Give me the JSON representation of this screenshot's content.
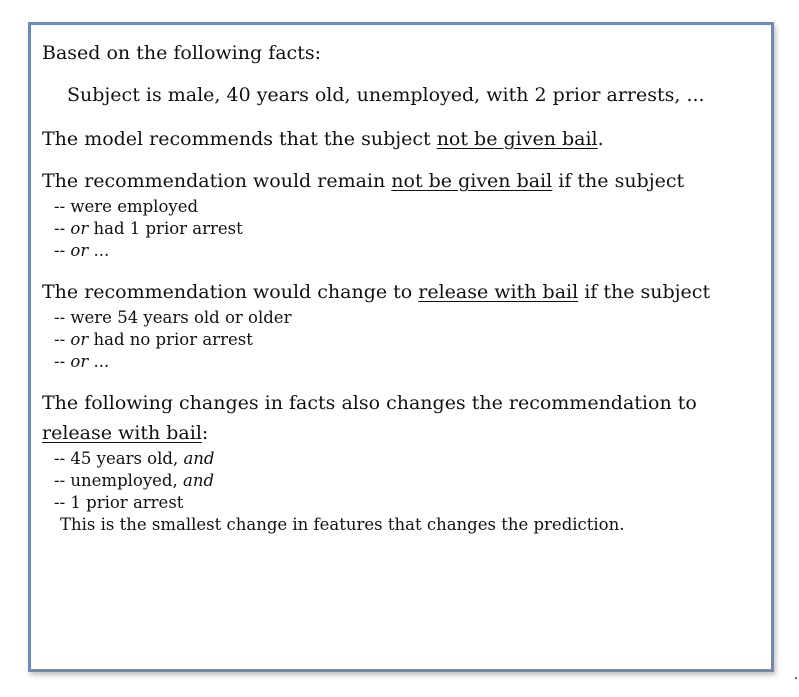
{
  "intro": "Based on the following facts:",
  "facts": "Subject is male, 40 years old, unemployed, with 2 prior arrests, ...",
  "recommend": {
    "prefix": "The model recommends that the subject ",
    "decision": "not be given bail",
    "suffix": "."
  },
  "remain": {
    "prefix": "The recommendation would remain ",
    "decision": "not be given bail",
    "suffix": " if the subject",
    "items": [
      {
        "dash": "-- ",
        "conj": "",
        "text": "were employed"
      },
      {
        "dash": "-- ",
        "conj": "or",
        "text": " had 1 prior arrest"
      },
      {
        "dash": "-- ",
        "conj": "or",
        "text": " ..."
      }
    ]
  },
  "change": {
    "prefix": "The recommendation would change to ",
    "decision": "release with bail",
    "suffix": " if the subject",
    "items": [
      {
        "dash": "-- ",
        "conj": "",
        "text": "were 54 years old or older"
      },
      {
        "dash": "-- ",
        "conj": "or",
        "text": " had no prior arrest"
      },
      {
        "dash": "-- ",
        "conj": "or",
        "text": " ..."
      }
    ]
  },
  "following": {
    "line1": "The following changes in facts also changes the recommendation to",
    "decision": "release with bail",
    "suffix": ":",
    "items": [
      {
        "dash": "-- ",
        "text": "45 years old, ",
        "conj": "and"
      },
      {
        "dash": "-- ",
        "text": "unemployed, ",
        "conj": "and"
      },
      {
        "dash": "-- ",
        "text": "1 prior arrest",
        "conj": ""
      }
    ],
    "note": "This is the smallest change in features that changes the prediction."
  },
  "colors": {
    "border": "#6f89b5",
    "text": "#111111"
  }
}
